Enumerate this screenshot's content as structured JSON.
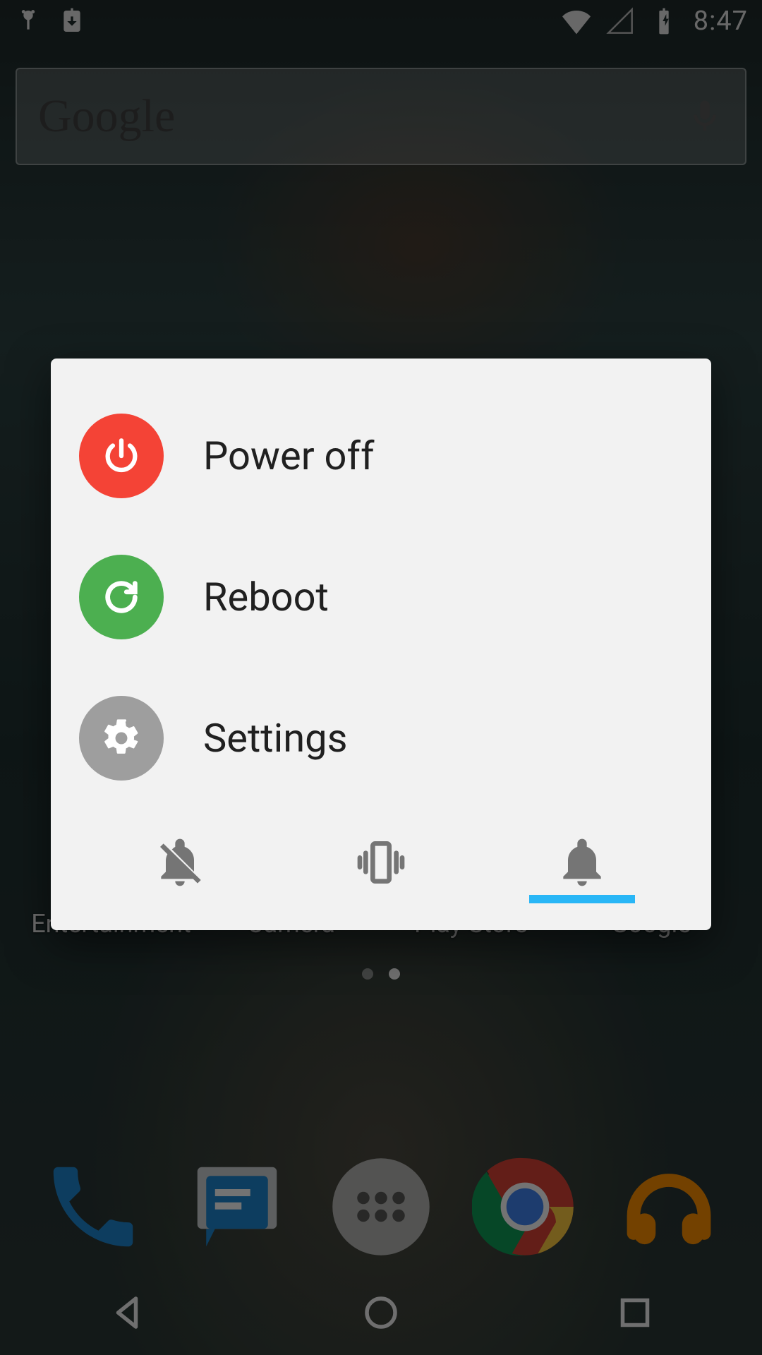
{
  "status": {
    "clock": "8:47"
  },
  "search": {
    "logo_text": "Google"
  },
  "power_menu": {
    "items": [
      {
        "label": "Power off"
      },
      {
        "label": "Reboot"
      },
      {
        "label": "Settings"
      }
    ]
  },
  "home_apps": [
    {
      "label": "Entertainment"
    },
    {
      "label": "Camera"
    },
    {
      "label": "Play Store"
    },
    {
      "label": "Google"
    }
  ],
  "colors": {
    "power_off": "#f44336",
    "reboot": "#4caf50",
    "settings": "#9e9e9e",
    "ringer_active": "#29b6f6"
  }
}
